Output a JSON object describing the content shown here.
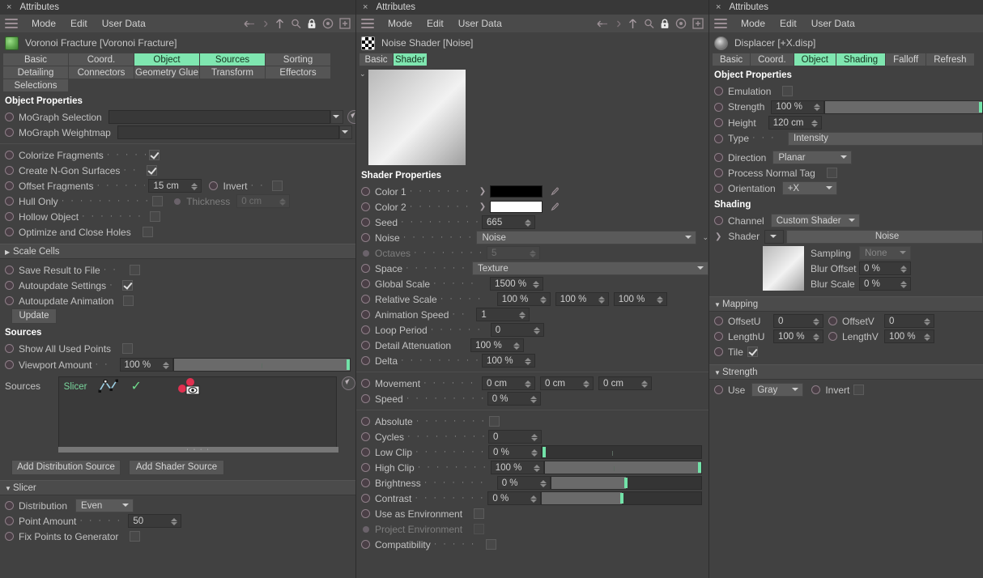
{
  "panel1": {
    "window_title": "Attributes",
    "menu": [
      "Mode",
      "Edit",
      "User Data"
    ],
    "object_title": "Voronoi Fracture [Voronoi Fracture]",
    "tabs_row1": [
      "Basic",
      "Coord.",
      "Object",
      "Sources",
      "Sorting"
    ],
    "tabs_row2": [
      "Detailing",
      "Connectors",
      "Geometry Glue",
      "Transform",
      "Effectors"
    ],
    "tabs_row3": [
      "Selections"
    ],
    "active_tabs": [
      "Object",
      "Sources"
    ],
    "object_properties_header": "Object Properties",
    "mograph_selection": {
      "label": "MoGraph Selection",
      "value": ""
    },
    "mograph_weightmap": {
      "label": "MoGraph Weightmap",
      "value": ""
    },
    "colorize_fragments": {
      "label": "Colorize Fragments",
      "checked": true
    },
    "create_ngon": {
      "label": "Create N-Gon Surfaces",
      "checked": true
    },
    "offset_fragments": {
      "label": "Offset Fragments",
      "value": "15 cm"
    },
    "invert": {
      "label": "Invert",
      "checked": false
    },
    "hull_only": {
      "label": "Hull Only",
      "checked": false
    },
    "thickness": {
      "label": "Thickness",
      "value": "0 cm"
    },
    "hollow_object": {
      "label": "Hollow Object",
      "checked": false
    },
    "optimize_close_holes": {
      "label": "Optimize and Close Holes",
      "checked": false
    },
    "scale_cells_group": "Scale Cells",
    "save_result": {
      "label": "Save Result to File",
      "checked": false
    },
    "autoupdate_settings": {
      "label": "Autoupdate Settings",
      "checked": true
    },
    "autoupdate_animation": {
      "label": "Autoupdate Animation",
      "checked": false
    },
    "update_button": "Update",
    "sources_header": "Sources",
    "show_all_used_points": {
      "label": "Show All Used Points",
      "checked": false
    },
    "viewport_amount": {
      "label": "Viewport Amount",
      "value": "100 %",
      "percent": 100
    },
    "sources_list_label": "Sources",
    "source_item_name": "Slicer",
    "add_distribution_source": "Add Distribution Source",
    "add_shader_source": "Add Shader Source",
    "slicer_group": "Slicer",
    "distribution": {
      "label": "Distribution",
      "value": "Even"
    },
    "point_amount": {
      "label": "Point Amount",
      "value": "50"
    },
    "fix_points": {
      "label": "Fix Points to Generator",
      "checked": false
    }
  },
  "panel2": {
    "window_title": "Attributes",
    "menu": [
      "Mode",
      "Edit",
      "User Data"
    ],
    "object_title": "Noise Shader [Noise]",
    "tabs": [
      "Basic",
      "Shader"
    ],
    "active_tab": "Shader",
    "shader_properties_header": "Shader Properties",
    "color1": {
      "label": "Color 1",
      "hex": "#000000"
    },
    "color2": {
      "label": "Color 2",
      "hex": "#ffffff"
    },
    "seed": {
      "label": "Seed",
      "value": "665"
    },
    "noise": {
      "label": "Noise",
      "value": "Noise"
    },
    "octaves": {
      "label": "Octaves",
      "value": "5",
      "disabled": true
    },
    "space": {
      "label": "Space",
      "value": "Texture"
    },
    "global_scale": {
      "label": "Global Scale",
      "value": "1500 %"
    },
    "relative_scale": {
      "label": "Relative Scale",
      "values": [
        "100 %",
        "100 %",
        "100 %"
      ]
    },
    "animation_speed": {
      "label": "Animation Speed",
      "value": "1"
    },
    "loop_period": {
      "label": "Loop Period",
      "value": "0"
    },
    "detail_attenuation": {
      "label": "Detail Attenuation",
      "value": "100 %"
    },
    "delta": {
      "label": "Delta",
      "value": "100 %"
    },
    "movement": {
      "label": "Movement",
      "values": [
        "0 cm",
        "0 cm",
        "0 cm"
      ]
    },
    "speed": {
      "label": "Speed",
      "value": "0 %"
    },
    "absolute": {
      "label": "Absolute",
      "checked": false
    },
    "cycles": {
      "label": "Cycles",
      "value": "0"
    },
    "low_clip": {
      "label": "Low Clip",
      "value": "0 %",
      "percent": 0
    },
    "high_clip": {
      "label": "High Clip",
      "value": "100 %",
      "percent": 100
    },
    "brightness": {
      "label": "Brightness",
      "value": "0 %",
      "percent": 50
    },
    "contrast": {
      "label": "Contrast",
      "value": "0 %",
      "percent": 50
    },
    "use_as_environment": {
      "label": "Use as Environment",
      "checked": false
    },
    "project_environment": {
      "label": "Project Environment",
      "checked": false,
      "disabled": true
    },
    "compatibility": {
      "label": "Compatibility",
      "checked": false
    }
  },
  "panel3": {
    "window_title": "Attributes",
    "menu": [
      "Mode",
      "Edit",
      "User Data"
    ],
    "object_title": "Displacer [+X.disp]",
    "tabs": [
      "Basic",
      "Coord.",
      "Object",
      "Shading",
      "Falloff",
      "Refresh"
    ],
    "active_tabs": [
      "Object",
      "Shading"
    ],
    "object_properties_header": "Object Properties",
    "emulation": {
      "label": "Emulation",
      "checked": false
    },
    "strength": {
      "label": "Strength",
      "value": "100 %",
      "percent": 100
    },
    "height": {
      "label": "Height",
      "value": "120 cm"
    },
    "type": {
      "label": "Type",
      "value": "Intensity"
    },
    "direction": {
      "label": "Direction",
      "value": "Planar"
    },
    "process_normal_tag": {
      "label": "Process Normal Tag",
      "checked": false
    },
    "orientation": {
      "label": "Orientation",
      "value": "+X"
    },
    "shading_header": "Shading",
    "channel": {
      "label": "Channel",
      "value": "Custom Shader"
    },
    "shader": {
      "label": "Shader",
      "value": "Noise"
    },
    "sampling": {
      "label": "Sampling",
      "value": "None",
      "disabled": true
    },
    "blur_offset": {
      "label": "Blur Offset",
      "value": "0 %"
    },
    "blur_scale": {
      "label": "Blur Scale",
      "value": "0 %"
    },
    "mapping_group": "Mapping",
    "offset_u": {
      "label": "OffsetU",
      "value": "0"
    },
    "offset_v": {
      "label": "OffsetV",
      "value": "0"
    },
    "length_u": {
      "label": "LengthU",
      "value": "100 %"
    },
    "length_v": {
      "label": "LengthV",
      "value": "100 %"
    },
    "tile": {
      "label": "Tile",
      "checked": true
    },
    "strength_group": "Strength",
    "use": {
      "label": "Use",
      "value": "Gray"
    },
    "invert": {
      "label": "Invert",
      "checked": false
    }
  },
  "icons": {
    "close": "×",
    "back": "back-arrow-icon",
    "forward": "forward-arrow-icon",
    "up": "up-arrow-icon",
    "search": "search-icon",
    "lock": "lock-icon",
    "target": "target-icon",
    "add": "add-icon"
  },
  "colors": {
    "accent_green": "#7fe6b0",
    "slider_green": "#72e2a8",
    "panel_bg": "#414141",
    "field_bg": "#3a3a3a"
  }
}
